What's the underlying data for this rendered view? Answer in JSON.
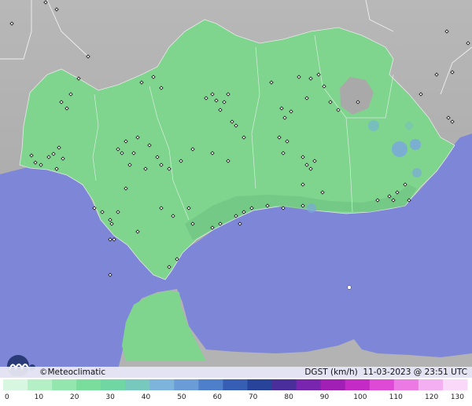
{
  "brand": {
    "name": "Meteoclimatic",
    "copyright": "©"
  },
  "caption": {
    "variable": "DGST",
    "unit": "(km/h)",
    "datetime": "11-03-2023 @ 23:51 UTC"
  },
  "legend": {
    "tick_labels": [
      "0",
      "10",
      "20",
      "30",
      "40",
      "50",
      "60",
      "70",
      "80",
      "90",
      "100",
      "110",
      "120",
      "130"
    ],
    "colors": [
      "#d8f7e0",
      "#b4efc6",
      "#93e7ae",
      "#79dd9c",
      "#6fd6a4",
      "#77c8bd",
      "#7cb4dc",
      "#6a9cd8",
      "#4d7fca",
      "#365fb4",
      "#27439a",
      "#4a2f9a",
      "#7a25b0",
      "#a020b6",
      "#c42ac4",
      "#de4ad6",
      "#ec7ae4",
      "#f4aef2",
      "#fad8fa"
    ],
    "color_domain": [
      0,
      130
    ]
  },
  "map": {
    "land_color": "#bcbcbc",
    "sea_color": "#7e86d8",
    "region_color": "#7fd58e",
    "station_color": "#111111"
  }
}
